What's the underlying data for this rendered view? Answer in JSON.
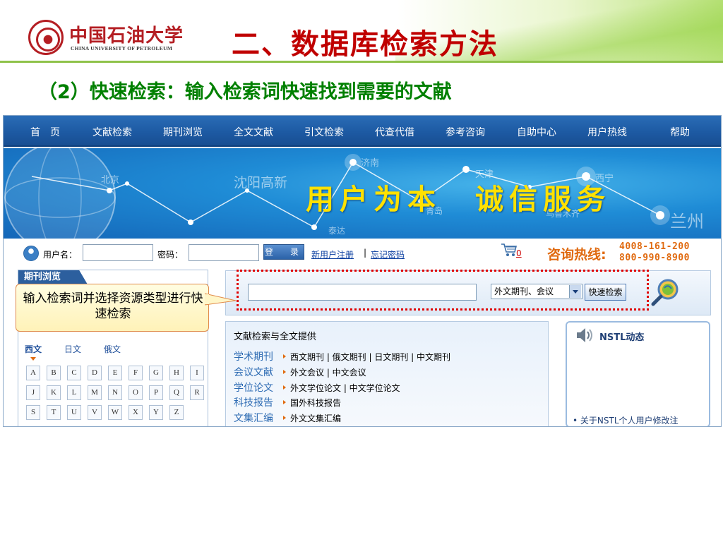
{
  "slide": {
    "logo_cn": "中国石油大学",
    "logo_en": "CHINA UNIVERSITY OF PETROLEUM",
    "title": "二、数据库检索方法",
    "subtitle": "（2）快速检索：输入检索词快速找到需要的文献",
    "callout": "输入检索词并选择资源类型进行快速检索"
  },
  "site": {
    "nav": [
      "首　页",
      "文献检索",
      "期刊浏览",
      "全文文献",
      "引文检索",
      "代查代借",
      "参考咨询",
      "自助中心",
      "用户热线",
      "帮助"
    ],
    "banner": {
      "slogan": "用户为本　诚信服务",
      "cities": [
        "北京",
        "沈阳高新",
        "济南",
        "天津",
        "西宁",
        "青岛",
        "泰达",
        "乌鲁木齐",
        "兰州"
      ]
    },
    "login": {
      "username_label": "用户名：",
      "password_label": "密码：",
      "login_button": "登　录",
      "register_link": "新用户注册",
      "separator": "|",
      "forgot_link": "忘记密码",
      "cart_count": "0",
      "hotline_label": "咨询热线:",
      "hotline_numbers": [
        "4008-161-200",
        "800-990-8900"
      ]
    },
    "journal_browse": {
      "tab": "期刊浏览",
      "languages": [
        "西文",
        "日文",
        "俄文"
      ],
      "letters": [
        "A",
        "B",
        "C",
        "D",
        "E",
        "F",
        "G",
        "H",
        "I",
        "J",
        "K",
        "L",
        "M",
        "N",
        "O",
        "P",
        "Q",
        "R",
        "S",
        "T",
        "U",
        "V",
        "W",
        "X",
        "Y",
        "Z"
      ]
    },
    "search": {
      "input_value": "",
      "selected_type": "外文期刊、会议",
      "button": "快速检索"
    },
    "literature": {
      "title": "文献检索与全文提供",
      "categories": [
        {
          "name": "学术期刊",
          "links": "西文期刊 | 俄文期刊 | 日文期刊 | 中文期刊"
        },
        {
          "name": "会议文献",
          "links": "外文会议 | 中文会议"
        },
        {
          "name": "学位论文",
          "links": "外文学位论文 | 中文学位论文"
        },
        {
          "name": "科技报告",
          "links": "国外科技报告"
        },
        {
          "name": "文集汇编",
          "links": "外文文集汇编"
        }
      ]
    },
    "nstl": {
      "title": "NSTL动态",
      "news": [
        "•  关于NSTL个人用户修改注"
      ]
    }
  },
  "colors": {
    "title_red": "#c00000",
    "subtitle_green": "#008000",
    "nav_blue": "#1d5aa3",
    "hotline_orange": "#e06a10",
    "highlight_red": "#e00000"
  }
}
